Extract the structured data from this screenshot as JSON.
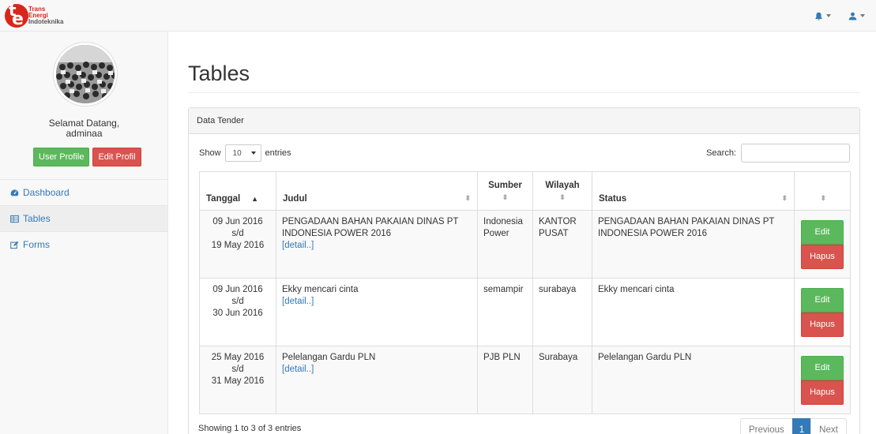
{
  "brand": {
    "line1": "Trans",
    "line2": "Energi",
    "line3": "Indoteknika",
    "logo_letters": "te",
    "color": "#d9261c"
  },
  "navbar": {
    "bell_icon": "bell-icon",
    "user_icon": "user-icon"
  },
  "sidebar": {
    "welcome": "Selamat Datang,",
    "username": "adminaa",
    "user_profile_label": "User Profile",
    "edit_profile_label": "Edit Profil",
    "items": [
      {
        "label": "Dashboard",
        "icon": "dashboard-icon"
      },
      {
        "label": "Tables",
        "icon": "table-icon",
        "active": true
      },
      {
        "label": "Forms",
        "icon": "edit-icon"
      }
    ]
  },
  "page": {
    "title": "Tables"
  },
  "panel": {
    "heading": "Data Tender",
    "show_label": "Show",
    "entries_value": "10",
    "entries_label": "entries",
    "search_label": "Search:",
    "search_value": "",
    "columns": [
      "Tanggal",
      "Judul",
      "Sumber",
      "Wilayah",
      "Status",
      ""
    ],
    "rows": [
      {
        "date_start": "09 Jun 2016",
        "sd": "s/d",
        "date_end": "19 May 2016",
        "judul": "PENGADAAN BAHAN PAKAIAN DINAS PT INDONESIA POWER 2016",
        "detail": "[detail..]",
        "sumber": "Indonesia Power",
        "wilayah": "KANTOR PUSAT",
        "status": "PENGADAAN BAHAN PAKAIAN DINAS PT INDONESIA POWER 2016",
        "edit": "Edit",
        "hapus": "Hapus"
      },
      {
        "date_start": "09 Jun 2016",
        "sd": "s/d",
        "date_end": "30 Jun 2016",
        "judul": "Ekky mencari cinta",
        "detail": "[detail..]",
        "sumber": "semampir",
        "wilayah": "surabaya",
        "status": "Ekky mencari cinta",
        "edit": "Edit",
        "hapus": "Hapus"
      },
      {
        "date_start": "25 May 2016",
        "sd": "s/d",
        "date_end": "31 May 2016",
        "judul": "Pelelangan Gardu PLN",
        "detail": "[detail..]",
        "sumber": "PJB PLN",
        "wilayah": "Surabaya",
        "status": "Pelelangan Gardu PLN",
        "edit": "Edit",
        "hapus": "Hapus"
      }
    ],
    "info": "Showing 1 to 3 of 3 entries",
    "pager": {
      "previous": "Previous",
      "current": "1",
      "next": "Next"
    }
  },
  "colors": {
    "primary": "#337ab7",
    "success": "#5cb85c",
    "danger": "#d9534f"
  }
}
